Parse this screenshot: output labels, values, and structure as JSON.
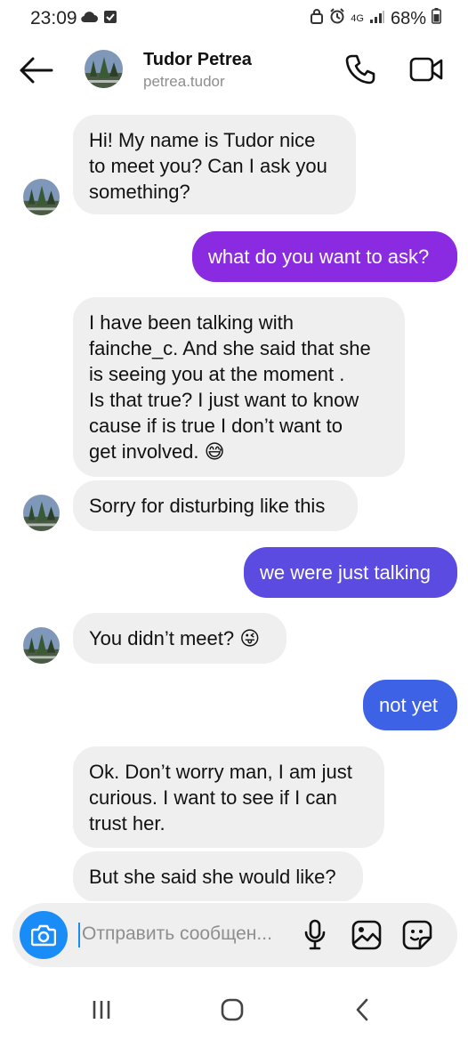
{
  "status_bar": {
    "time": "23:09",
    "network": "4G",
    "battery": "68%"
  },
  "header": {
    "name": "Tudor Petrea",
    "username": "petrea.tudor",
    "back_icon": "arrow-left-icon",
    "call_icon": "phone-icon",
    "video_icon": "video-camera-icon"
  },
  "colors": {
    "outgoing_top": "#8a2be2",
    "outgoing_mid": "#5b4be0",
    "outgoing_bottom": "#3e62e6",
    "incoming": "#efefef",
    "accent": "#1a8cf7"
  },
  "messages": [
    {
      "direction": "in",
      "text": "Hi! My name is Tudor nice\nto meet you? Can I ask you\nsomething?"
    },
    {
      "direction": "out",
      "text": "what do you want to ask?"
    },
    {
      "direction": "in",
      "text": "I have been talking with\nfainche_c. And she said that she\nis seeing you at the moment .\nIs that true? I just want to know\ncause if is true I don’t want to\nget involved. 😅"
    },
    {
      "direction": "in",
      "text": "Sorry for disturbing like this"
    },
    {
      "direction": "out",
      "text": "we were just talking"
    },
    {
      "direction": "in",
      "text": "You didn’t meet? 😜"
    },
    {
      "direction": "out",
      "text": "not yet"
    },
    {
      "direction": "in",
      "text": "Ok. Don’t worry man, I am just\ncurious. I want to see if I can\ntrust her."
    },
    {
      "direction": "in",
      "text": "But she said she would like?"
    }
  ],
  "composer": {
    "placeholder": "Отправить сообщен...",
    "camera_icon": "camera-icon",
    "mic_icon": "microphone-icon",
    "gallery_icon": "image-icon",
    "sticker_icon": "sticker-icon"
  },
  "nav_bar": {
    "recent_icon": "recent-apps-icon",
    "home_icon": "home-icon",
    "back_icon": "back-chevron-icon"
  }
}
